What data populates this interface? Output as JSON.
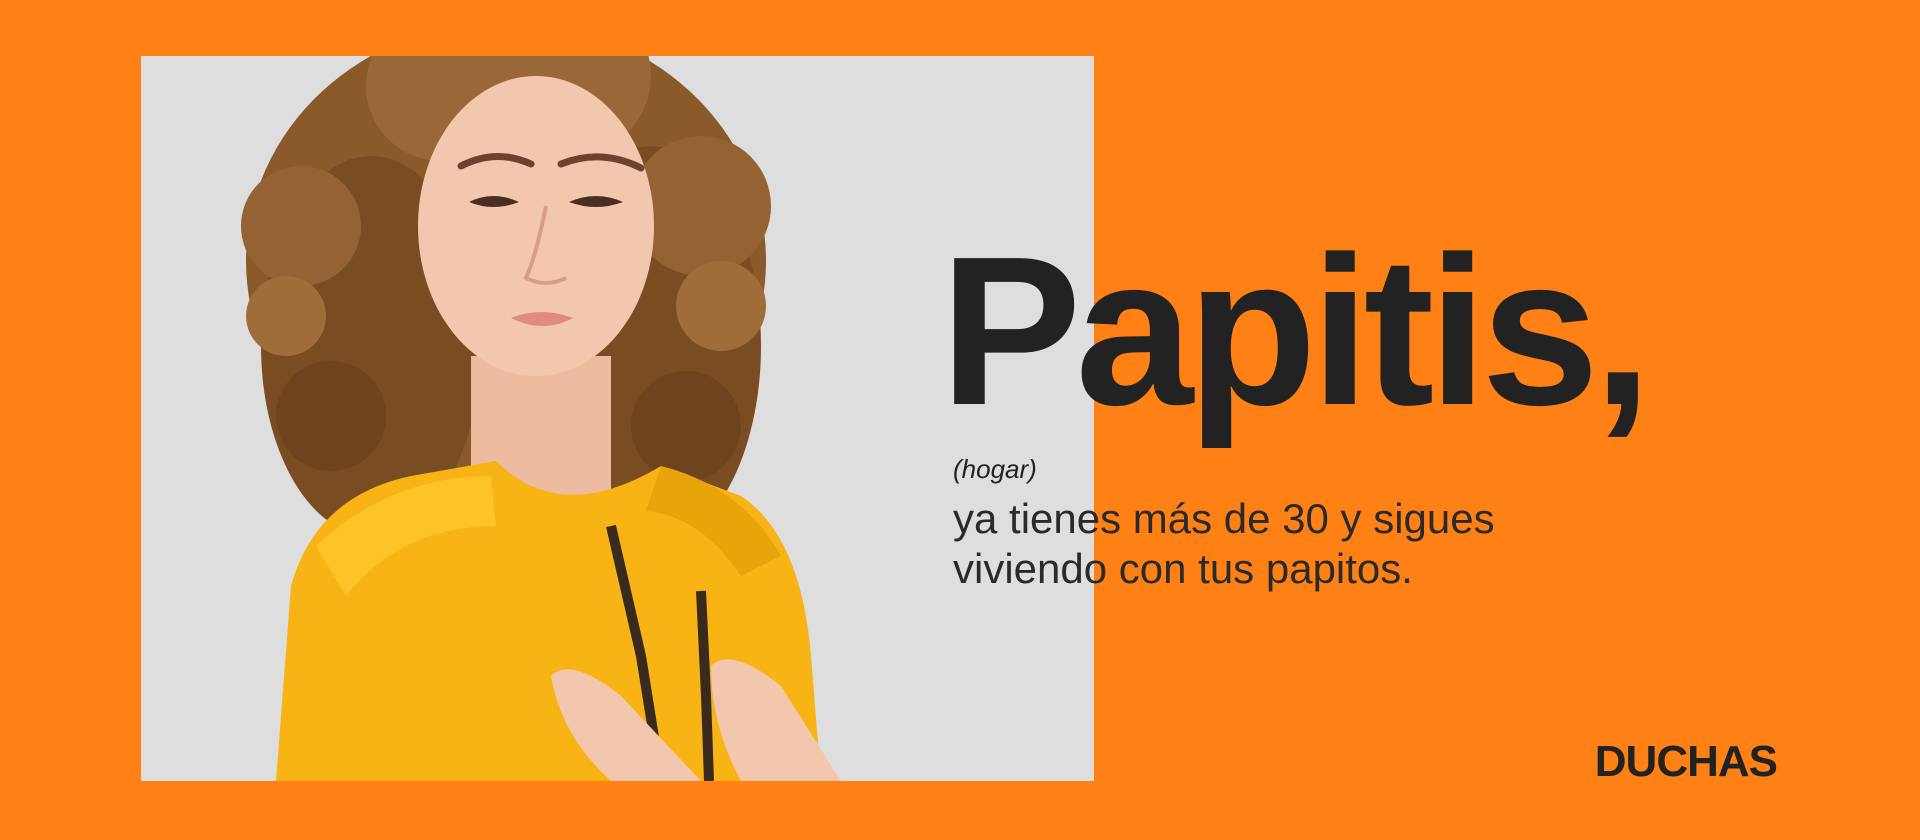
{
  "ad": {
    "headline": "Papitis,",
    "category": "(hogar)",
    "definition_lines": [
      "ya tienes más de 30 y sigues",
      "viviendo con tus papitos."
    ],
    "brand": "DUCHAS"
  },
  "colors": {
    "background": "#FF8116",
    "photo_backdrop": "#DEDEDE",
    "text": "#222222",
    "hoodie": "#F7B414",
    "hair": "#8A5A2B",
    "skin": "#F2C7AE"
  },
  "photo": {
    "subject": "woman-with-curly-hair-in-yellow-hoodie"
  }
}
